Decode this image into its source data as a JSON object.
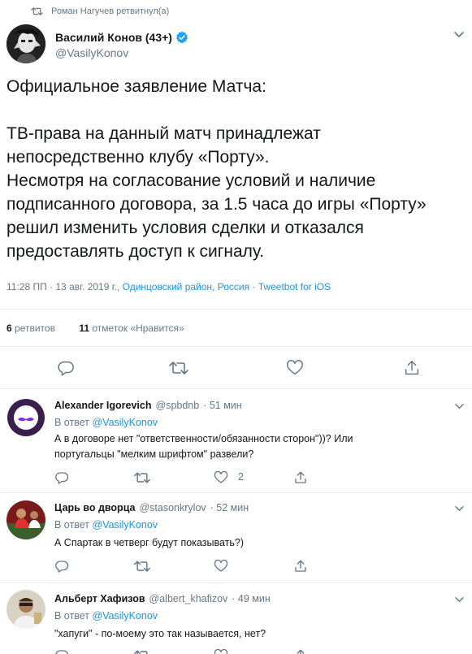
{
  "retweet_context": "Роман Нагучев ретвитнул(а)",
  "tweet": {
    "author_name": "Василий Конов (43+)",
    "author_handle": "@VasilyKonov",
    "text_lines": [
      "Официальное заявление Матча:",
      "",
      "ТВ-права на данный матч принадлежат",
      "непосредственно клубу «Порту».",
      "Несмотря на согласование условий и наличие",
      "подписанного договора, за 1.5 часа до игры «Порту»",
      "решил изменить условия сделки и отказался",
      "предоставлять доступ к сигналу."
    ],
    "time": "11:28 ПП · 13 авг. 2019 г.,",
    "location": "Одинцовский район, Россия",
    "separator": "·",
    "source": "Tweetbot for iOS",
    "retweets_count": "6",
    "retweets_label": "ретвитов",
    "likes_count": "11",
    "likes_label": "отметок «Нравится»"
  },
  "replies": [
    {
      "name": "Alexander Igorevich",
      "handle": "@spbdnb",
      "time": "· 51 мин",
      "in_reply_prefix": "В ответ",
      "in_reply_handle": "@VasilyKonov",
      "text_lines": [
        "А в договоре нет \"ответственности/обязанности сторон\"))?  Или",
        "португальцы \"мелким шрифтом\" развели?"
      ],
      "likes": "2"
    },
    {
      "name": "Царь во дворца",
      "handle": "@stasonkrylov",
      "time": "· 52 мин",
      "in_reply_prefix": "В ответ",
      "in_reply_handle": "@VasilyKonov",
      "text_lines": [
        "А Спартак в четверг будут показывать?)"
      ],
      "likes": ""
    },
    {
      "name": "Альберт Хафизов",
      "handle": "@albert_khafizov",
      "time": "· 49 мин",
      "in_reply_prefix": "В ответ",
      "in_reply_handle": "@VasilyKonov",
      "text_lines": [
        "\"хапуги\" - по-моему это так называется, нет?"
      ],
      "likes": ""
    }
  ],
  "colors": {
    "text": "#14171a",
    "muted": "#657786",
    "link": "#1b95e0",
    "divider": "#e6ecf0"
  },
  "icons": {
    "retweet": "retweet-icon",
    "reply": "reply-icon",
    "like": "heart-icon",
    "share": "share-icon",
    "verified": "verified-badge-icon",
    "menu": "chevron-down-icon"
  }
}
